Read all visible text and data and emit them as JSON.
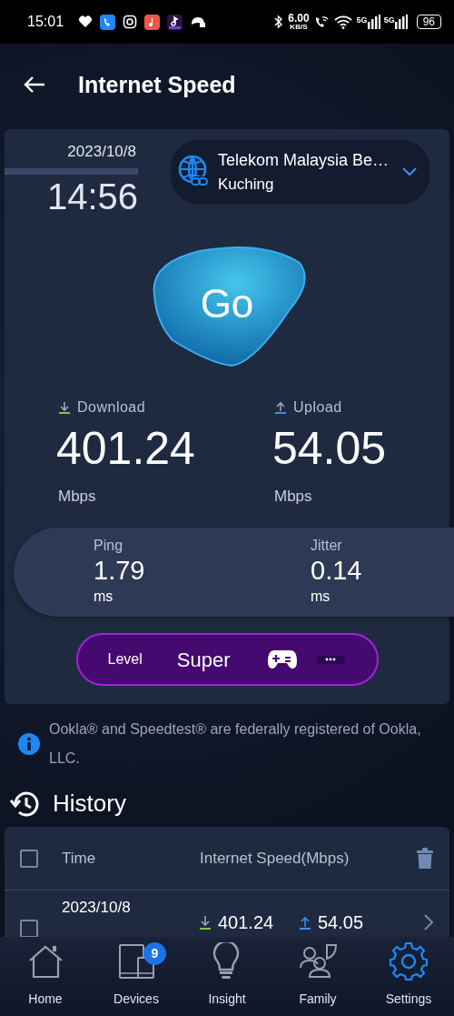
{
  "status_bar": {
    "time": "15:01",
    "net_speed": "6.00",
    "net_unit": "KB/S",
    "network_1": "5G",
    "network_2": "5G",
    "battery": "96"
  },
  "header": {
    "title": "Internet Speed"
  },
  "test": {
    "date": "2023/10/8",
    "time": "14:56",
    "server": {
      "name": "Telekom Malaysia Be…",
      "location": "Kuching"
    },
    "go_button": "Go",
    "download": {
      "label": "Download",
      "value": "401.24",
      "unit": "Mbps"
    },
    "upload": {
      "label": "Upload",
      "value": "54.05",
      "unit": "Mbps"
    },
    "ping": {
      "label": "Ping",
      "value": "1.79",
      "unit": "ms"
    },
    "jitter": {
      "label": "Jitter",
      "value": "0.14",
      "unit": "ms"
    },
    "level": {
      "label": "Level",
      "value": "Super"
    }
  },
  "notice": "Ookla® and Speedtest® are federally registered of Ookla, LLC.",
  "history": {
    "title": "History",
    "select_all_checked": false,
    "columns": [
      "Time",
      "Internet Speed(Mbps)"
    ],
    "rows": [
      {
        "date": "2023/10/8",
        "download": "401.24",
        "upload": "54.05",
        "checked": false
      }
    ]
  },
  "nav": [
    {
      "kind": "home",
      "label": "Home",
      "selected": false
    },
    {
      "kind": "devices",
      "label": "Devices",
      "badge": "9",
      "selected": false
    },
    {
      "kind": "insight",
      "label": "Insight",
      "selected": false
    },
    {
      "kind": "family",
      "label": "Family",
      "selected": false
    },
    {
      "kind": "settings",
      "label": "Settings",
      "selected": true
    }
  ]
}
